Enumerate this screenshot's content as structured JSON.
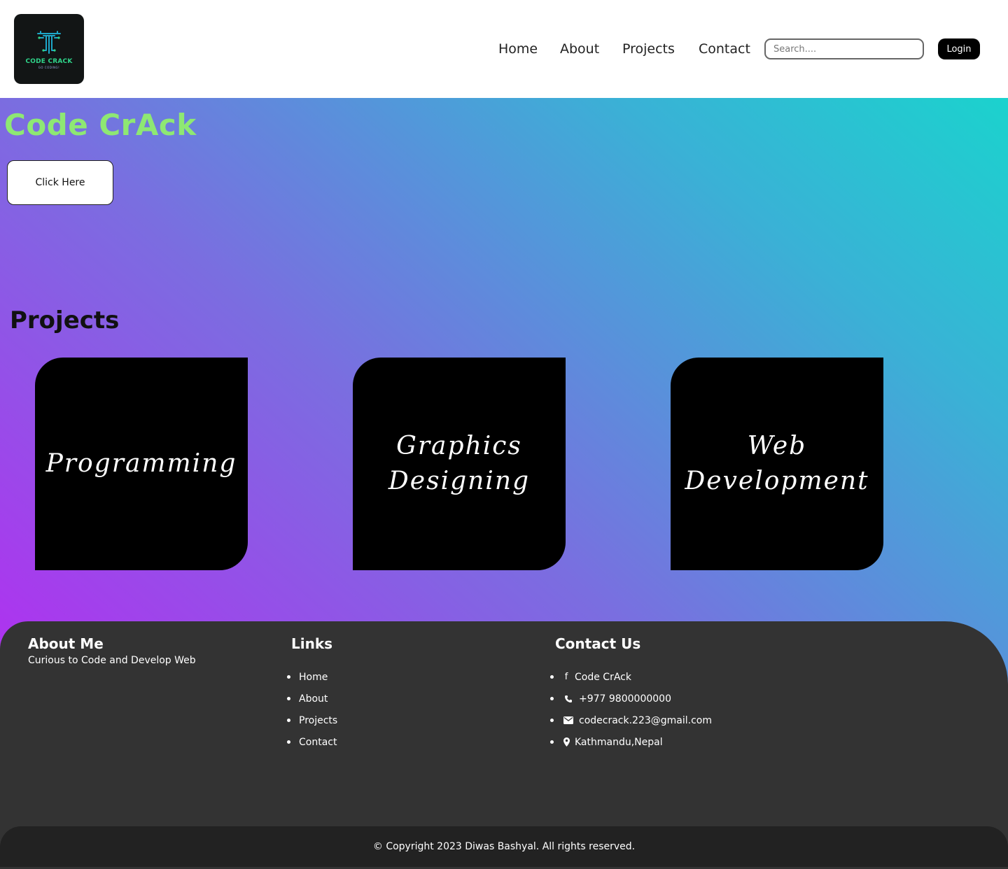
{
  "header": {
    "logo": {
      "name": "CODE CRACK",
      "tagline": "GO CODING!"
    },
    "nav": [
      "Home",
      "About",
      "Projects",
      "Contact"
    ],
    "search_placeholder": "Search....",
    "login_label": "Login"
  },
  "hero": {
    "title": "Code CrAck",
    "button_label": "Click Here"
  },
  "projects": {
    "title": "Projects",
    "cards": [
      "Programming",
      "Graphics Designing",
      "Web Development"
    ]
  },
  "footer": {
    "about": {
      "title": "About Me",
      "text": "Curious to Code and Develop Web"
    },
    "links": {
      "title": "Links",
      "items": [
        "Home",
        "About",
        "Projects",
        "Contact"
      ]
    },
    "contact": {
      "title": "Contact Us",
      "items": [
        {
          "icon": "facebook-icon",
          "text": "Code CrAck"
        },
        {
          "icon": "phone-icon",
          "text": "+977 9800000000"
        },
        {
          "icon": "envelope-icon",
          "text": "codecrack.223@gmail.com"
        },
        {
          "icon": "map-marker-icon",
          "text": "Kathmandu,Nepal"
        }
      ]
    },
    "copyright": "© Copyright 2023 Diwas Bashyal. All rights reserved."
  },
  "colors": {
    "hero_title": "#8ee873",
    "footer_bg": "#333333",
    "copyright_bg": "#222222",
    "card_bg": "#000000"
  }
}
